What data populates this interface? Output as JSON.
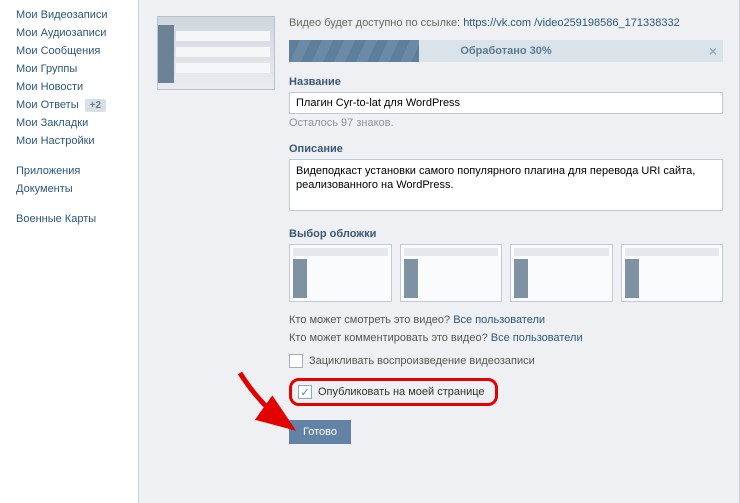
{
  "sidebar": {
    "group1": [
      "Мои Видеозаписи",
      "Мои Аудиозаписи",
      "Мои Сообщения",
      "Мои Группы",
      "Мои Новости"
    ],
    "answers": {
      "label": "Мои Ответы",
      "badge": "+2"
    },
    "group1b": [
      "Мои Закладки",
      "Мои Настройки"
    ],
    "group2": [
      "Приложения",
      "Документы"
    ],
    "group3": [
      "Военные Карты"
    ]
  },
  "form": {
    "avail_prefix": "Видео будет доступно по ссылке:",
    "avail_link": "https://vk.com /video259198586_171338332",
    "progress": {
      "percent": 30,
      "label": "Обработано 30%"
    },
    "title_label": "Название",
    "title_value": "Плагин Cyr-to-lat для WordPress",
    "title_hint": "Осталось 97 знаков.",
    "desc_label": "Описание",
    "desc_value": "Видеподкаст установки самого популярного плагина для перевода URI сайта, реализованного на WordPress.",
    "cover_label": "Выбор обложки",
    "priv_view_q": "Кто может смотреть это видео?",
    "priv_view_a": "Все пользователи",
    "priv_comm_q": "Кто может комментировать это видео?",
    "priv_comm_a": "Все пользователи",
    "loop_label": "Зацикливать воспроизведение видеозаписи",
    "publish_label": "Опубликовать на моей странице",
    "done": "Готово"
  }
}
